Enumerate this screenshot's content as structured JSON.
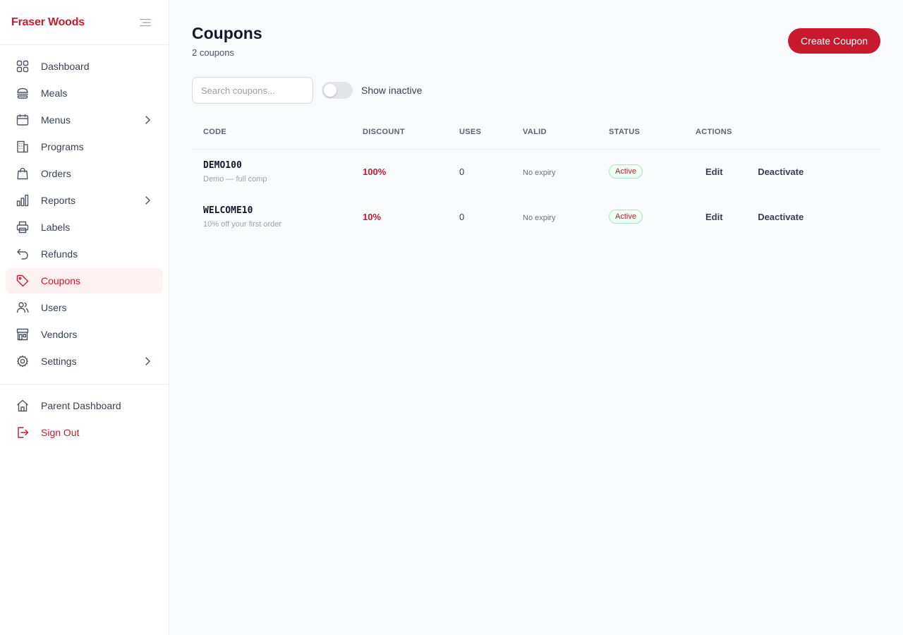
{
  "brand": "Fraser Woods",
  "nav": [
    {
      "label": "Dashboard",
      "icon": "grid-icon",
      "chevron": false,
      "active": false
    },
    {
      "label": "Meals",
      "icon": "burger-icon",
      "chevron": false,
      "active": false
    },
    {
      "label": "Menus",
      "icon": "calendar-icon",
      "chevron": true,
      "active": false
    },
    {
      "label": "Programs",
      "icon": "building-icon",
      "chevron": false,
      "active": false
    },
    {
      "label": "Orders",
      "icon": "shopping-bag-icon",
      "chevron": false,
      "active": false
    },
    {
      "label": "Reports",
      "icon": "bar-chart-icon",
      "chevron": true,
      "active": false
    },
    {
      "label": "Labels",
      "icon": "printer-icon",
      "chevron": false,
      "active": false
    },
    {
      "label": "Refunds",
      "icon": "undo-arrow-icon",
      "chevron": false,
      "active": false
    },
    {
      "label": "Coupons",
      "icon": "tag-icon",
      "chevron": false,
      "active": true
    },
    {
      "label": "Users",
      "icon": "users-icon",
      "chevron": false,
      "active": false
    },
    {
      "label": "Vendors",
      "icon": "storefront-icon",
      "chevron": false,
      "active": false
    },
    {
      "label": "Settings",
      "icon": "gear-icon",
      "chevron": true,
      "active": false
    }
  ],
  "bottom_nav": {
    "parent_dashboard": "Parent Dashboard",
    "sign_out": "Sign Out"
  },
  "page": {
    "title": "Coupons",
    "subtitle": "2 coupons",
    "create_button": "Create Coupon",
    "search_placeholder": "Search coupons...",
    "show_inactive_label": "Show inactive",
    "show_inactive": false
  },
  "table": {
    "headers": [
      "CODE",
      "DISCOUNT",
      "USES",
      "VALID",
      "STATUS",
      "ACTIONS"
    ],
    "rows": [
      {
        "code": "DEMO100",
        "description": "Demo — full comp",
        "discount": "100%",
        "uses": "0",
        "valid": "No expiry",
        "status": "Active",
        "edit": "Edit",
        "deactivate": "Deactivate"
      },
      {
        "code": "WELCOME10",
        "description": "10% off your first order",
        "discount": "10%",
        "uses": "0",
        "valid": "No expiry",
        "status": "Active",
        "edit": "Edit",
        "deactivate": "Deactivate"
      }
    ]
  },
  "colors": {
    "accent": "#c8192f",
    "active_bg": "#fdf1f2",
    "badge_border": "#a7e8bf"
  }
}
